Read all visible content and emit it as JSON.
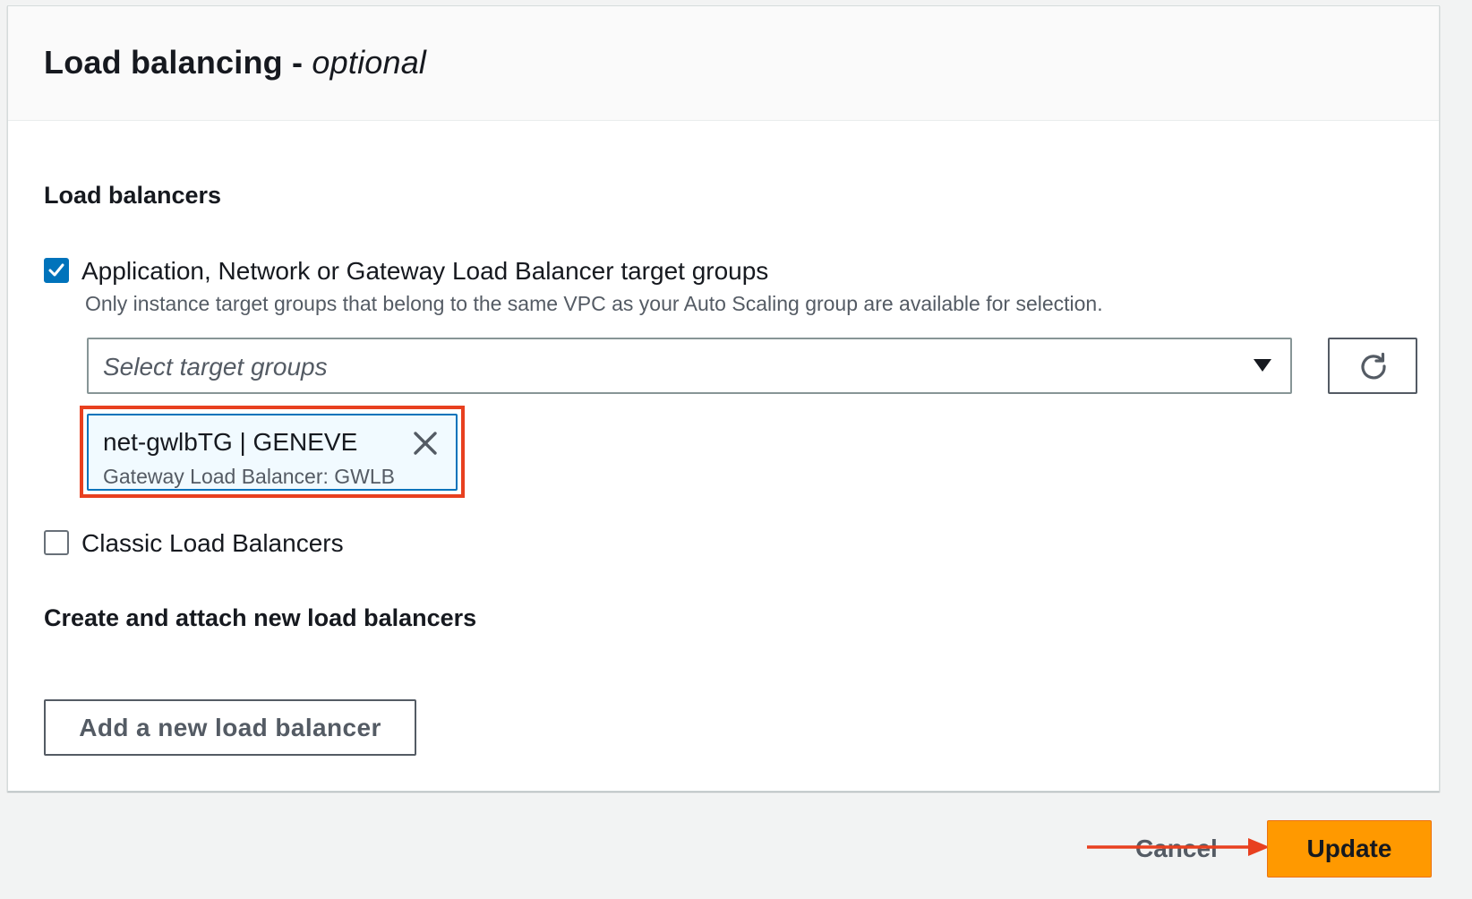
{
  "panel": {
    "title": "Load balancing - ",
    "title_optional": "optional"
  },
  "load_balancers": {
    "section_title": "Load balancers",
    "target_groups_checkbox": {
      "label": "Application, Network or Gateway Load Balancer target groups",
      "checked": true
    },
    "hint": "Only instance target groups that belong to the same VPC as your Auto Scaling group are available for selection.",
    "select": {
      "placeholder": "Select target groups"
    },
    "selected_token": {
      "name": "net-gwlbTG | GENEVE",
      "description": "Gateway Load Balancer: GWLB"
    },
    "classic_checkbox": {
      "label": "Classic Load Balancers",
      "checked": false
    }
  },
  "create_section": {
    "title": "Create and attach new load balancers",
    "add_button": "Add a new load balancer"
  },
  "footer": {
    "cancel": "Cancel",
    "update": "Update"
  },
  "icons": {
    "checkmark": "check-icon",
    "caret": "caret-down-icon",
    "refresh": "refresh-icon",
    "dismiss": "close-icon",
    "annotation": "arrow-right-icon"
  },
  "colors": {
    "primary": "#ff9900",
    "checkbox": "#0073bb",
    "annotation": "#e8401f"
  }
}
